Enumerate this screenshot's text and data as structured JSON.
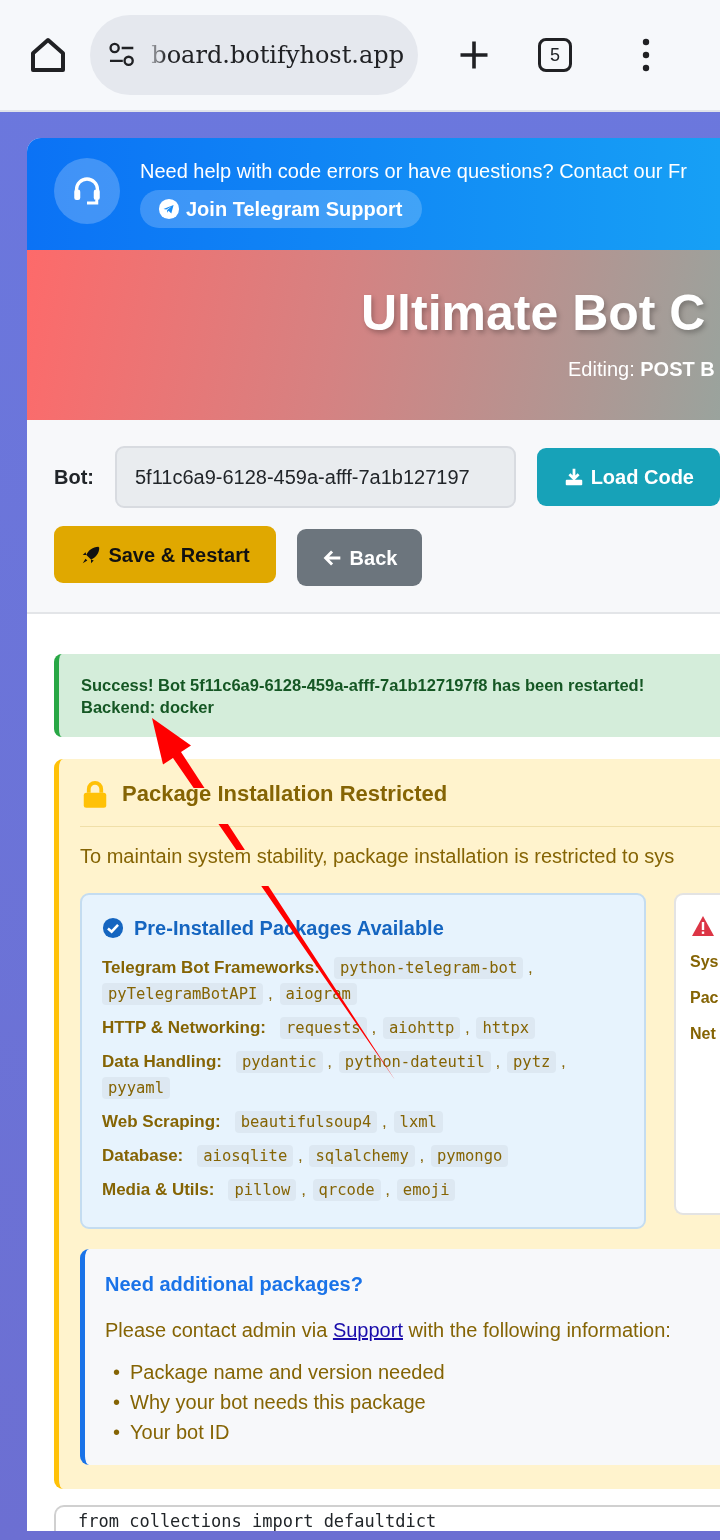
{
  "browser": {
    "url": "board.botifyhost.app",
    "tab_count": "5"
  },
  "help_banner": {
    "text": "Need help with code errors or have questions? Contact our Fr",
    "button": "Join Telegram Support"
  },
  "header": {
    "title": "Ultimate Bot C",
    "subtitle": "Editing: **POST B**"
  },
  "toolbar": {
    "bot_label": "Bot:",
    "bot_id": "5f11c6a9-6128-459a-afff-7a1b127197",
    "buttons": [
      {
        "kind": "load",
        "label": "Load Code"
      },
      {
        "kind": "save",
        "label": "Save & Restart"
      },
      {
        "kind": "back",
        "label": "Back"
      }
    ]
  },
  "alert": {
    "lines": [
      "Success! Bot 5f11c6a9-6128-459a-afff-7a1b127197f8 has been restarted!",
      "Backend: docker"
    ]
  },
  "restriction": {
    "title": "Package Installation Restricted",
    "intro": "To maintain system stability, package installation is restricted to sys",
    "preinstalled": {
      "title": "Pre-Installed Packages Available",
      "separator": ",",
      "groups": [
        {
          "label": "Telegram Bot Frameworks:",
          "packages": [
            "python-telegram-bot",
            "pyTelegramBotAPI",
            "aiogram"
          ]
        },
        {
          "label": "HTTP & Networking:",
          "packages": [
            "requests",
            "aiohttp",
            "httpx"
          ]
        },
        {
          "label": "Data Handling:",
          "packages": [
            "pydantic",
            "python-dateutil",
            "pytz",
            "pyyaml"
          ]
        },
        {
          "label": "Web Scraping:",
          "packages": [
            "beautifulsoup4",
            "lxml"
          ]
        },
        {
          "label": "Database:",
          "packages": [
            "aiosqlite",
            "sqlalchemy",
            "pymongo"
          ]
        },
        {
          "label": "Media & Utils:",
          "packages": [
            "pillow",
            "qrcode",
            "emoji"
          ]
        }
      ]
    },
    "limits": {
      "labels": [
        "Sys",
        "Pac",
        "Net"
      ]
    },
    "help": {
      "title": "Need additional packages?",
      "text_before": "Please contact admin via ",
      "link": "Support",
      "text_after": " with the following information:",
      "bullet": "•",
      "items": [
        "Package name and version needed",
        "Why your bot needs this package",
        "Your bot ID"
      ]
    }
  },
  "editor": {
    "lines": [
      "from collections import defaultdict"
    ]
  }
}
